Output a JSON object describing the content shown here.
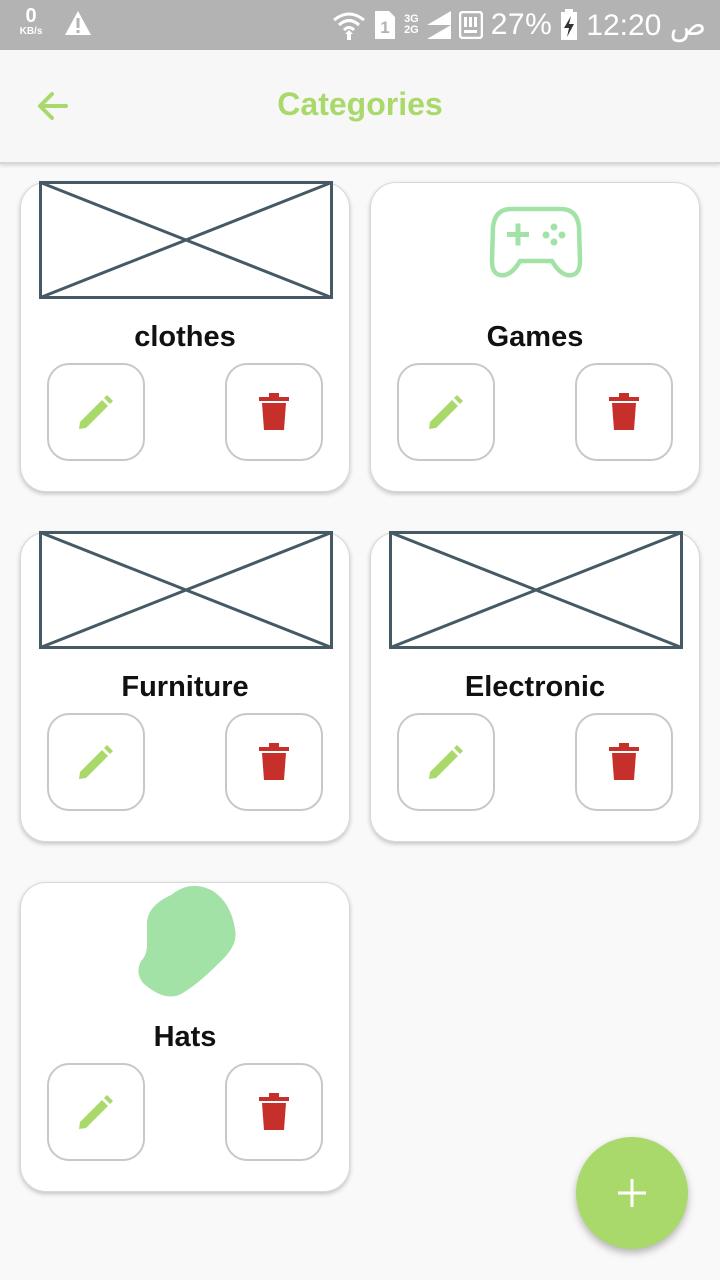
{
  "status_bar": {
    "data_speed_value": "0",
    "data_speed_unit": "KB/s",
    "net_3g": "3G",
    "net_2g": "2G",
    "battery": "27%",
    "time": "12:20 ص",
    "sim_slot": "1"
  },
  "header": {
    "title": "Categories",
    "accent_color": "#a9d96b"
  },
  "categories": [
    {
      "name": "clothes",
      "image": "placeholder-image"
    },
    {
      "name": "Games",
      "image": "gamepad-icon"
    },
    {
      "name": "Furniture",
      "image": "placeholder-image"
    },
    {
      "name": "Electronic",
      "image": "placeholder-image"
    },
    {
      "name": "Hats",
      "image": "hat-blob-image"
    }
  ],
  "actions": {
    "edit_icon": "pencil-icon",
    "delete_icon": "trash-icon",
    "delete_color": "#c62f2a",
    "add_icon": "plus-icon"
  }
}
